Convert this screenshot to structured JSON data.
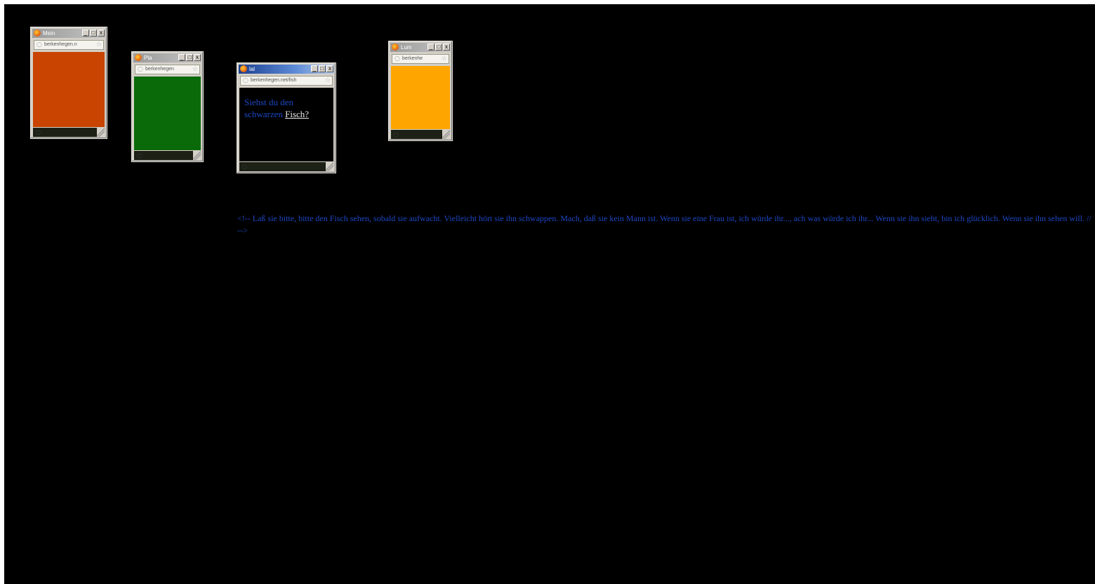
{
  "popups": [
    {
      "title": "Mein",
      "url": "berkenhegen.n",
      "color": "#c84400"
    },
    {
      "title": "Pla",
      "url": "berkenhegen",
      "color": "#0a6a0a"
    },
    {
      "title": "lal",
      "url": "berkenhegen.net/fish",
      "color": "#000000"
    },
    {
      "title": "Lum",
      "url": "berkenhe",
      "color": "#ffa500"
    }
  ],
  "fish_window": {
    "question_text": "Siehst du den schwarzen",
    "link_text": "Fisch?"
  },
  "comment_text": "<!-- Laß sie bitte, bitte den Fisch sehen, sobald sie aufwacht. Vielleicht hört sie ihn schwappen. Mach, daß sie kein Mann ist. Wenn sie eine Frau ist, ich würde ihr..., ach was würde ich ihr... Wenn sie ihn sieht, bin ich glücklich. Wenn sie ihn sehen will. // -->",
  "icons": {
    "app": "firefox-icon",
    "url": "globe-icon",
    "bookmark": "star-icon",
    "minimize": "_",
    "maximize": "□",
    "close": "x"
  }
}
